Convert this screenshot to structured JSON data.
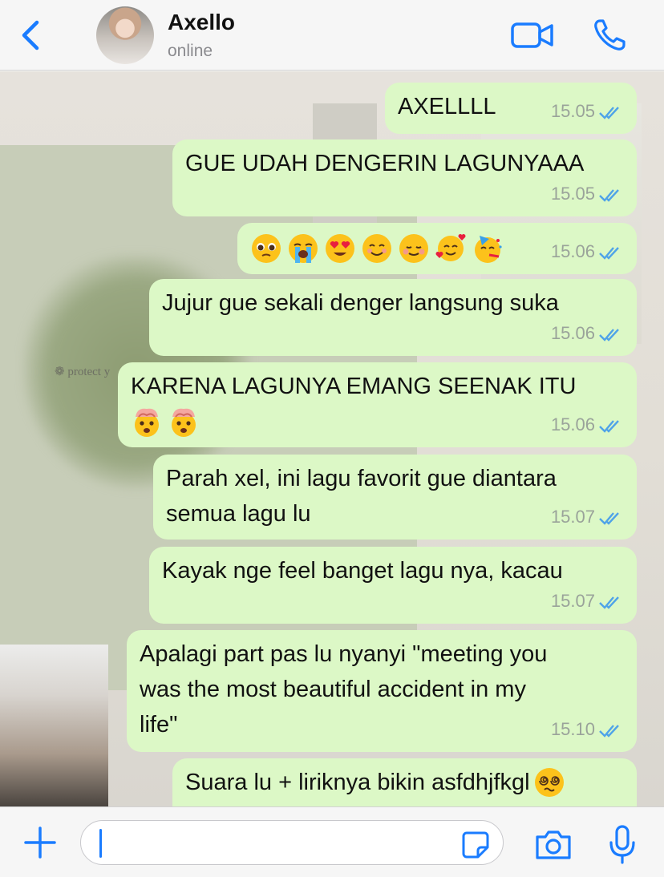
{
  "header": {
    "contact_name": "Axello",
    "status": "online",
    "icons": [
      "back-chevron-icon",
      "video-camera-icon",
      "phone-icon"
    ],
    "accent_color": "#1a7cff"
  },
  "messages": [
    {
      "text": "AXELLLL",
      "time": "15.05",
      "status": "read"
    },
    {
      "text": "GUE UDAH DENGERIN LAGUNYAAA",
      "time": "15.05",
      "status": "read"
    },
    {
      "emojis": [
        "pleading-face",
        "loudly-crying-face",
        "heart-eyes-face",
        "smiling-face",
        "blushing-smile-face",
        "smiling-face-with-hearts",
        "partying-face"
      ],
      "time": "15.06",
      "status": "read"
    },
    {
      "text": "Jujur gue sekali denger langsung suka",
      "time": "15.06",
      "status": "read"
    },
    {
      "text": "KARENA LAGUNYA EMANG SEENAK ITU",
      "emojis": [
        "exploding-head",
        "exploding-head"
      ],
      "time": "15.06",
      "status": "read"
    },
    {
      "text_lines": [
        "Parah xel, ini lagu favorit gue diantara",
        "semua lagu lu"
      ],
      "time": "15.07",
      "status": "read"
    },
    {
      "text": "Kayak nge feel banget lagu nya, kacau",
      "time": "15.07",
      "status": "read"
    },
    {
      "text_lines": [
        "Apalagi part pas lu nyanyi \"meeting you",
        "was the most beautiful accident in my",
        "life\""
      ],
      "time": "15.10",
      "status": "read"
    },
    {
      "text": "Suara lu + liriknya bikin asfdhjfkgl",
      "emojis": [
        "face-with-spiral-eyes"
      ]
    }
  ],
  "wallpaper": {
    "text": "❁ protect y"
  },
  "input_bar": {
    "placeholder": "",
    "icons": [
      "plus-icon",
      "sticker-icon",
      "camera-icon",
      "microphone-icon"
    ]
  },
  "colors": {
    "bubble_outgoing": "#dcf8c6",
    "read_ticks": "#4fa3e8",
    "accent": "#1a7cff"
  }
}
